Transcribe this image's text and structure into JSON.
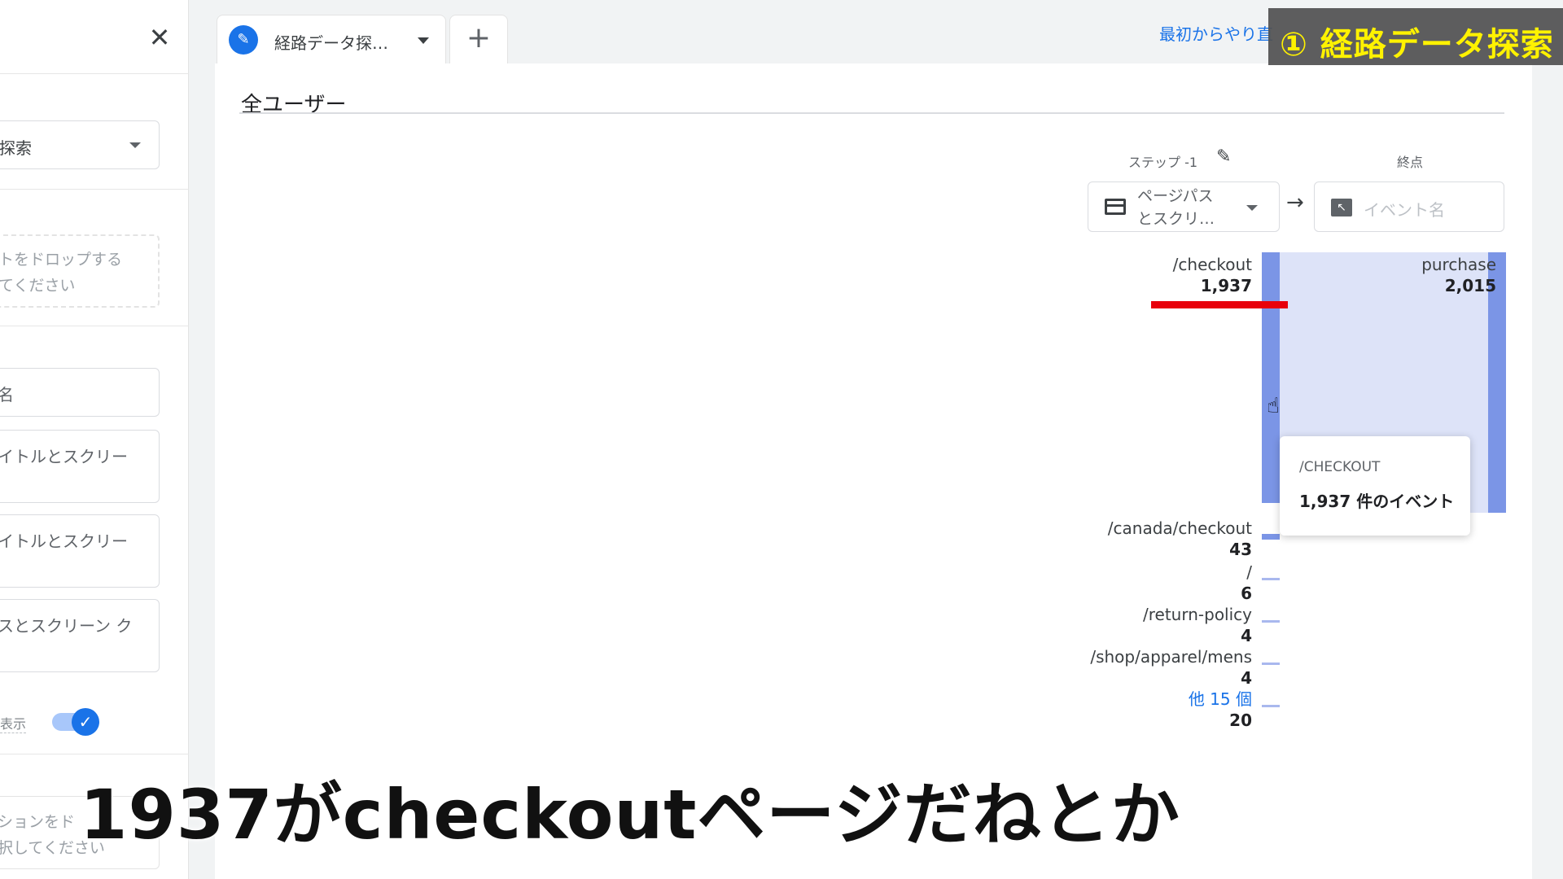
{
  "left_panel": {
    "select_value": "探索",
    "drop_hint_line1": "トをドロップする",
    "drop_hint_line2": "てください",
    "item1": "名",
    "item2": "イトルとスクリー",
    "item3": "イトルとスクリー",
    "item4": "スとスクリーン ク",
    "toggle_label": "表示",
    "bottom_hint_line1": "ションをド",
    "bottom_hint_line2": "択してください"
  },
  "tab": {
    "label": "経路データ探…",
    "add_label": "+"
  },
  "header": {
    "restart_link": "最初からやり直",
    "overlay_badge": "① 経路データ探索"
  },
  "segment": {
    "title": "全ユーザー"
  },
  "columns": {
    "step_label": "ステップ -1",
    "end_label": "終点",
    "dimension_line1": "ページパス",
    "dimension_line2": "とスクリ…",
    "event_placeholder": "イベント名"
  },
  "nodes": [
    {
      "name": "/checkout",
      "count": "1,937"
    },
    {
      "name": "/canada/checkout",
      "count": "43"
    },
    {
      "name": "/",
      "count": "6"
    },
    {
      "name": "/return-policy",
      "count": "4"
    },
    {
      "name": "/shop/apparel/mens",
      "count": "4"
    },
    {
      "name": "他 15 個",
      "count": "20"
    }
  ],
  "end_node": {
    "name": "purchase",
    "count": "2,015"
  },
  "tooltip": {
    "title": "/CHECKOUT",
    "value": "1,937 件のイベント"
  },
  "subtitle": "1937がcheckoutページだねとか",
  "colors": {
    "bar": "#7b95e6",
    "flow": "#dde3f8",
    "accent": "#1a73e8",
    "highlight": "#e8000b",
    "badge_text": "#fff200"
  }
}
